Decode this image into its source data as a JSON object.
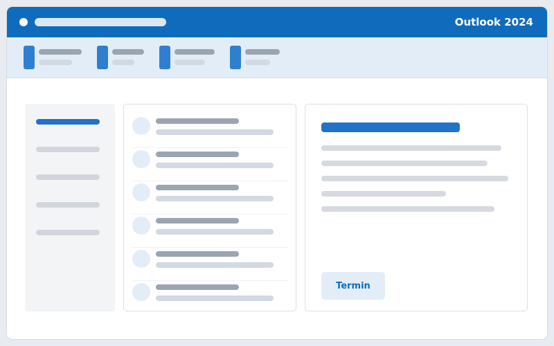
{
  "app": {
    "title": "Outlook 2024",
    "accent_color": "#0f6cbd"
  },
  "reading_pane": {
    "action_button_label": "Termin"
  }
}
